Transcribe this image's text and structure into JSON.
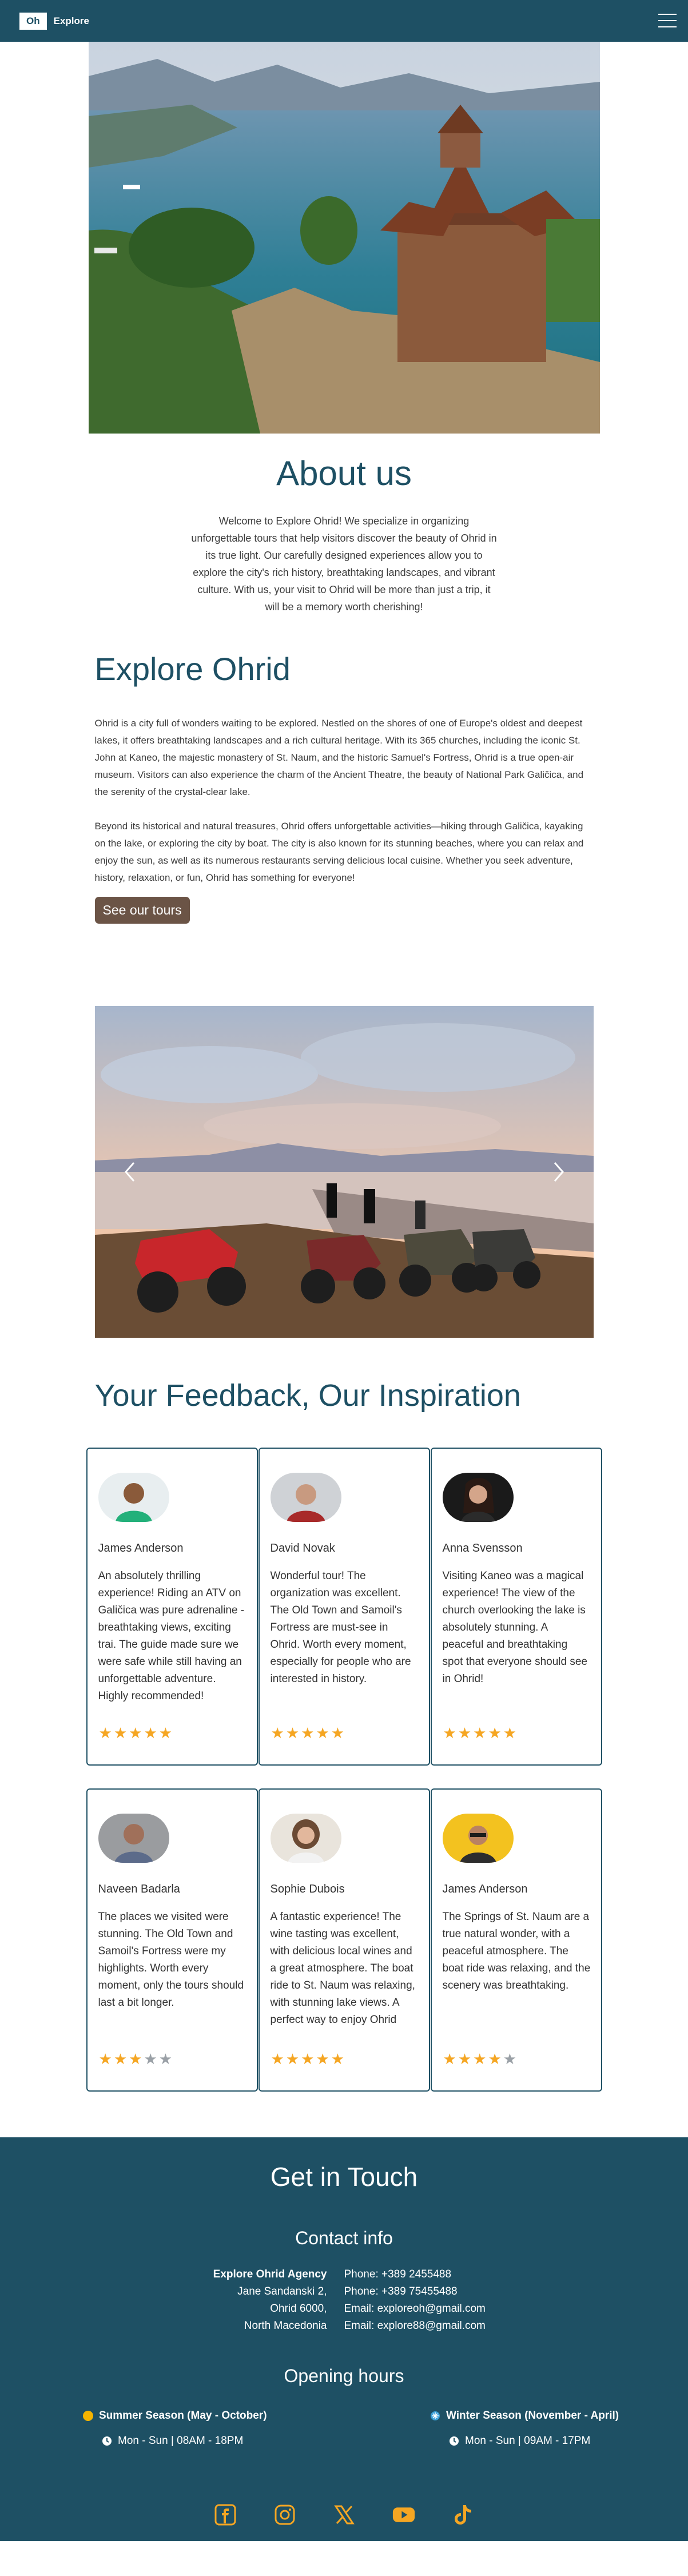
{
  "nav": {
    "logo": "Oh",
    "brand": "Explore"
  },
  "about": {
    "title": "About us",
    "text": "Welcome to Explore Ohrid! We specialize in organizing unforgettable tours that help visitors discover the beauty of Ohrid in its true light. Our carefully designed experiences allow you to explore the city's rich history, breathtaking landscapes, and vibrant culture. With us, your visit to Ohrid will be more than just a trip, it will be a memory worth cherishing!"
  },
  "explore": {
    "title": "Explore Ohrid",
    "p1": "Ohrid is a city full of wonders waiting to be explored. Nestled on the shores of one of Europe's oldest and deepest lakes, it offers breathtaking landscapes and a rich cultural heritage. With its 365 churches, including the iconic St. John at Kaneo, the majestic monastery of St. Naum, and the historic Samuel's Fortress, Ohrid is a true open-air museum. Visitors can also experience the charm of the Ancient Theatre, the beauty of National Park Galičica, and the serenity of the crystal-clear lake.",
    "p2": "Beyond its historical and natural treasures, Ohrid offers unforgettable activities—hiking through Galičica, kayaking on the lake, or exploring the city by boat. The city is also known for its stunning beaches, where you can relax and enjoy the sun, as well as its numerous restaurants serving delicious local cuisine. Whether you seek adventure, history, relaxation, or fun, Ohrid has something for everyone!",
    "button": "See our tours"
  },
  "feedback": {
    "title": "Your Feedback, Our Inspiration",
    "reviews": [
      {
        "name": "James Anderson",
        "text": "An absolutely thrilling experience! Riding an ATV on Galičica was pure adrenaline - breathtaking views, exciting trai. The guide made sure we were safe while still having an unforgettable adventure. Highly recommended!",
        "rating": 5
      },
      {
        "name": "David Novak",
        "text": "Wonderful tour! The organization was excellent. The Old Town and Samoil's Fortress are must-see in Ohrid. Worth every moment, especially for people who are interested in history.",
        "rating": 5
      },
      {
        "name": "Anna Svensson",
        "text": "Visiting Kaneo was a magical experience! The view of the church overlooking the lake is absolutely stunning. A peaceful and breathtaking spot that everyone should see in Ohrid!",
        "rating": 5
      },
      {
        "name": "Naveen Badarla",
        "text": "The places we visited were stunning. The Old Town and Samoil's Fortress were my highlights. Worth every moment, only the tours should last a bit longer.",
        "rating": 3
      },
      {
        "name": "Sophie Dubois",
        "text": "A fantastic experience! The wine tasting was excellent, with delicious local wines and a great atmosphere. The boat ride to St. Naum was relaxing, with stunning lake views. A perfect way to enjoy Ohrid",
        "rating": 5
      },
      {
        "name": "James Anderson",
        "text": "The Springs of St. Naum are a true natural wonder, with a peaceful atmosphere. The boat ride was relaxing, and the scenery was breathtaking.",
        "rating": 4
      }
    ]
  },
  "footer": {
    "title": "Get in Touch",
    "contact_title": "Contact info",
    "agency": "Explore Ohrid Agency",
    "street": "Jane Sandanski 2,",
    "city": "Ohrid 6000,",
    "country": "North Macedonia",
    "phone1": "Phone: +389 2455488",
    "phone2": "Phone: +389 75455488",
    "email1": "Email: exploreoh@gmail.com",
    "email2": "Email: explore88@gmail.com",
    "hours_title": "Opening hours",
    "summer_title": "Summer Season (May - October)",
    "summer_hours": "Mon - Sun | 08AM - 18PM",
    "winter_title": "Winter Season (November - April)",
    "winter_hours": "Mon - Sun | 09AM - 17PM"
  },
  "colors": {
    "primary": "#1e5064",
    "button": "#6b5446",
    "star": "#f5a623",
    "star_off": "#9aa0a6"
  },
  "socials": [
    "facebook-icon",
    "instagram-icon",
    "x-icon",
    "youtube-icon",
    "tiktok-icon"
  ]
}
